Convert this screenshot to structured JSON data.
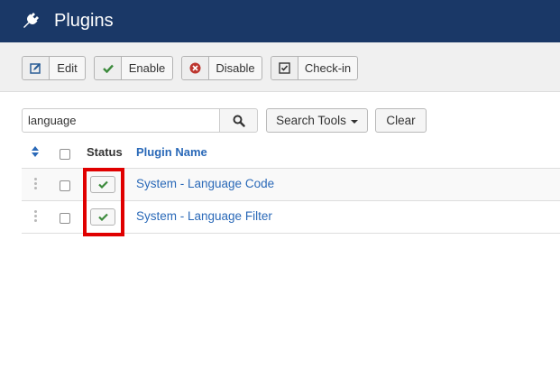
{
  "header": {
    "title": "Plugins",
    "icon": "plug-icon"
  },
  "toolbar": {
    "edit": {
      "label": "Edit",
      "icon": "edit-icon"
    },
    "enable": {
      "label": "Enable",
      "icon": "check-icon"
    },
    "disable": {
      "label": "Disable",
      "icon": "times-circle-icon"
    },
    "checkin": {
      "label": "Check-in",
      "icon": "check-square-icon"
    }
  },
  "filters": {
    "search_value": "language",
    "search_tools_label": "Search Tools",
    "clear_label": "Clear"
  },
  "table": {
    "headers": {
      "status": "Status",
      "name": "Plugin Name"
    },
    "rows": [
      {
        "name": "System - Language Code",
        "enabled": true
      },
      {
        "name": "System - Language Filter",
        "enabled": true
      }
    ]
  },
  "colors": {
    "header_bg": "#1a3867",
    "link": "#2a69b8",
    "enabled_check": "#3c8a3c",
    "disable_icon": "#bd362f",
    "highlight": "#e00000"
  }
}
